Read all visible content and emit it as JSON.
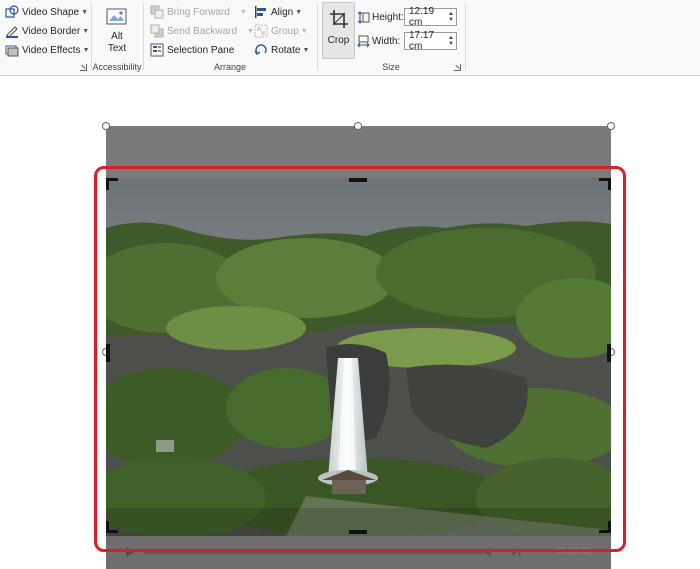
{
  "ribbon": {
    "video_style_items": [
      {
        "label": "Video Shape",
        "icon": "video-shape-icon"
      },
      {
        "label": "Video Border",
        "icon": "video-border-icon"
      },
      {
        "label": "Video Effects",
        "icon": "video-effects-icon"
      }
    ],
    "accessibility": {
      "alt_text_label": "Alt Text",
      "group_label": "Accessibility"
    },
    "arrange": {
      "bring_forward": "Bring Forward",
      "send_backward": "Send Backward",
      "selection_pane": "Selection Pane",
      "align": "Align",
      "group": "Group",
      "rotate": "Rotate",
      "group_label": "Arrange"
    },
    "size": {
      "crop_label": "Crop",
      "height_label": "Height:",
      "height_value": "12.19 cm",
      "width_label": "Width:",
      "width_value": "17.17 cm",
      "group_label": "Size"
    }
  },
  "video": {
    "time_display": "00:00.00",
    "highlight_color": "#d9202a"
  }
}
